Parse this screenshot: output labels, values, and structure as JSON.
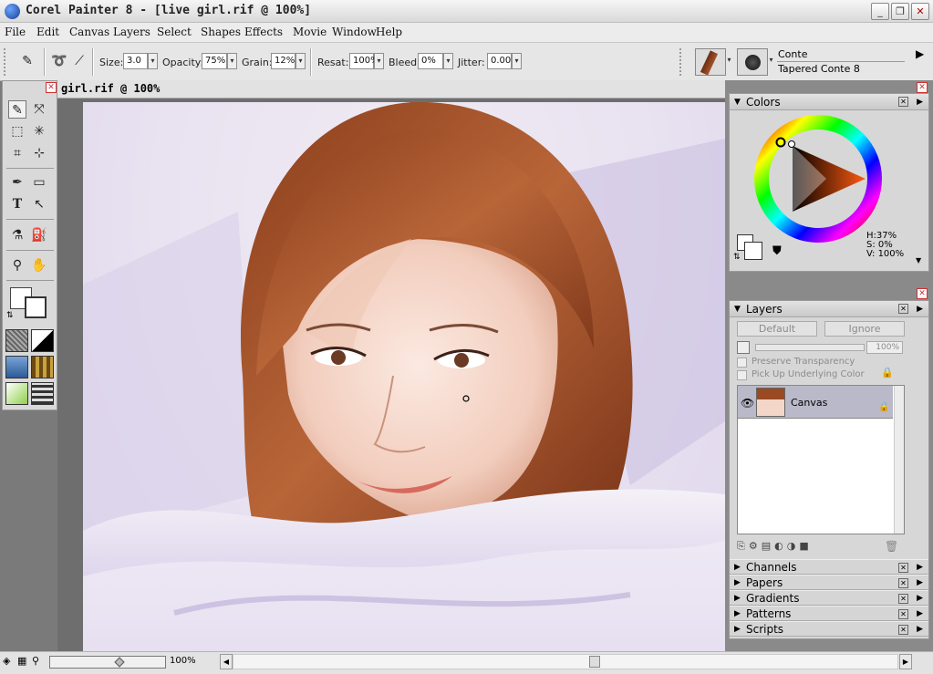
{
  "app": {
    "title": "Corel Painter 8 - [live girl.rif @ 100%]"
  },
  "window_controls": {
    "minimize": "_",
    "maximize": "❐",
    "close": "✕"
  },
  "menu": [
    "File",
    "Edit",
    "Canvas",
    "Layers",
    "Select",
    "Shapes",
    "Effects",
    "Movie",
    "Window",
    "Help"
  ],
  "property_bar": {
    "size_label": "Size:",
    "size_value": "3.0",
    "opacity_label": "Opacity:",
    "opacity_value": "75%",
    "grain_label": "Grain:",
    "grain_value": "12%",
    "resat_label": "Resat:",
    "resat_value": "100%",
    "bleed_label": "Bleed:",
    "bleed_value": "0%",
    "jitter_label": "Jitter:",
    "jitter_value": "0.00"
  },
  "brush_selector": {
    "category": "Conte",
    "variant": "Tapered Conte 8"
  },
  "document": {
    "title": "girl.rif @ 100%"
  },
  "colors_panel": {
    "title": "Colors",
    "hue": "H:37%",
    "saturation": "S: 0%",
    "value": "V: 100%",
    "primary_color": "#ffffff",
    "secondary_color": "#ffffff"
  },
  "layers_panel": {
    "title": "Layers",
    "composite_method": "Default",
    "composite_depth": "Ignore",
    "opacity": "100%",
    "preserve_transparency": "Preserve Transparency",
    "pick_up_underlying": "Pick Up Underlying Color",
    "layers": [
      {
        "name": "Canvas"
      }
    ]
  },
  "collapsed_panels": [
    "Channels",
    "Papers",
    "Gradients",
    "Patterns",
    "Scripts"
  ],
  "status": {
    "zoom": "100%"
  },
  "colors": {
    "accent": "#316ac5",
    "panel_bg": "#d7d7d7"
  }
}
